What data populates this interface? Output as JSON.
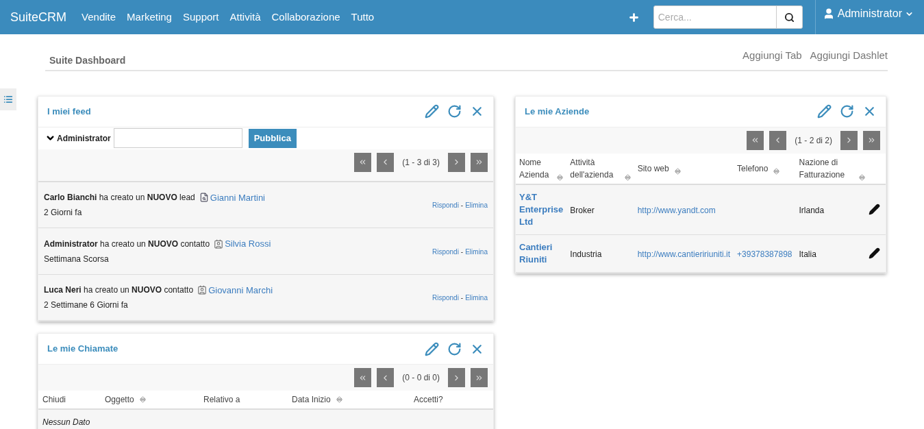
{
  "navbar": {
    "brand": "SuiteCRM",
    "menu": [
      "Vendite",
      "Marketing",
      "Support",
      "Attività",
      "Collaborazione",
      "Tutto"
    ],
    "search": {
      "placeholder": "Cerca..."
    },
    "user": "Administrator"
  },
  "dashboard": {
    "title": "Suite Dashboard",
    "actions": [
      "Aggiungi Tab",
      "Aggiungi Dashlet"
    ]
  },
  "feed": {
    "title": "I miei feed",
    "poster": "Administrator",
    "post_button": "Pubblica",
    "pagination": "(1 - 3 di 3)",
    "items": [
      {
        "text": "**Carlo Bianchi** ha creato un **NUOVO** lead",
        "kind": "lead",
        "link": "Gianni Martini",
        "time": "2 Giorni fa",
        "reply": "Rispondi",
        "separator": "-",
        "delete": "Elimina"
      },
      {
        "text": "**Administrator** ha creato un **NUOVO** contatto",
        "kind": "contact",
        "link": "Silvia Rossi",
        "time": "Settimana Scorsa",
        "reply": "Rispondi",
        "separator": "-",
        "delete": "Elimina"
      },
      {
        "text": "**Luca Neri** ha creato un **NUOVO** contatto",
        "kind": "contact",
        "link": "Giovanni Marchi",
        "time": "2 Settimane 6 Giorni fa",
        "reply": "Rispondi",
        "separator": "-",
        "delete": "Elimina"
      }
    ]
  },
  "calls": {
    "title": "Le mie Chiamate",
    "pagination": "(0 - 0 di 0)",
    "columns": [
      {
        "label": "Chiudi",
        "sortable": false
      },
      {
        "label": "Oggetto",
        "sortable": true
      },
      {
        "label": "Relativo a",
        "sortable": false
      },
      {
        "label": "Data Inizio",
        "sortable": true
      },
      {
        "label": "Accetti?",
        "sortable": false
      }
    ],
    "empty": "Nessun Dato"
  },
  "accounts": {
    "title": "Le mie Aziende",
    "pagination": "(1 - 2 di 2)",
    "columns": [
      {
        "label": "Nome Azienda",
        "sortable": true
      },
      {
        "label": "Attività dell'azienda",
        "sortable": true
      },
      {
        "label": "Sito web",
        "sortable": true
      },
      {
        "label": "Telefono",
        "sortable": true
      },
      {
        "label": "Nazione di Fatturazione",
        "sortable": true
      }
    ],
    "rows": [
      {
        "name": "Y&T Enterprise Ltd",
        "industry": "Broker",
        "website": "http://www.yandt.com",
        "phone": "",
        "country": "Irlanda"
      },
      {
        "name": "Cantieri Riuniti",
        "industry": "Industria",
        "website": "http://www.cantieririuniti.it",
        "phone": "+39378387898",
        "country": "Italia"
      }
    ]
  }
}
